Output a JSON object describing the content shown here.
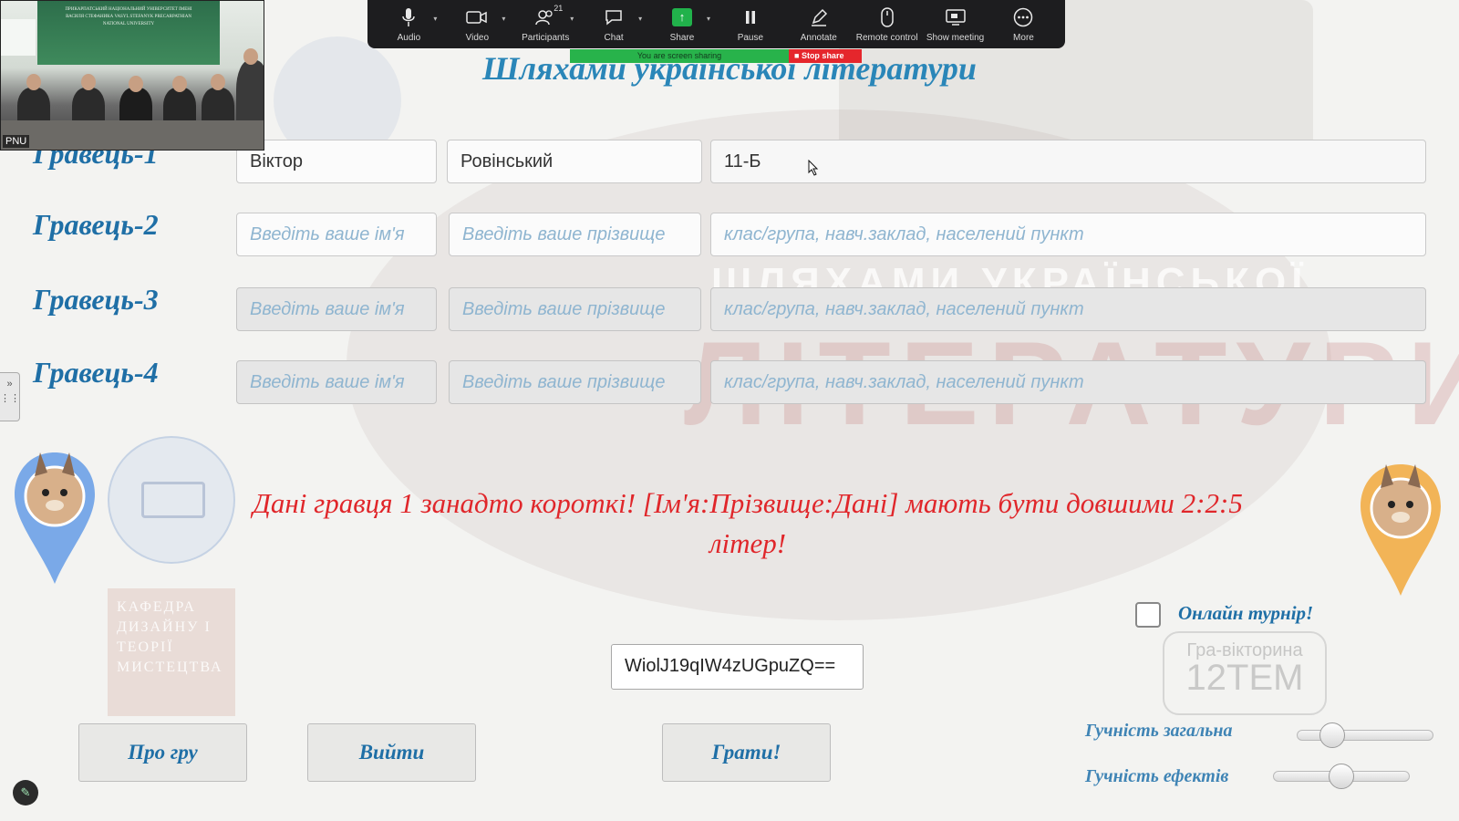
{
  "title": "Шляхами української літератури",
  "players": [
    {
      "label": "Гравець-1",
      "first_name": "Віктор",
      "last_name": "Ровінський",
      "info": "11-Б",
      "placeholder_first": "Введіть ваше ім'я",
      "placeholder_last": "Введіть ваше прізвище",
      "placeholder_info": "клас/група, навч.заклад, населений пункт"
    },
    {
      "label": "Гравець-2",
      "first_name": "",
      "last_name": "",
      "info": "",
      "placeholder_first": "Введіть ваше ім'я",
      "placeholder_last": "Введіть ваше прізвище",
      "placeholder_info": "клас/група, навч.заклад, населений пункт"
    },
    {
      "label": "Гравець-3",
      "first_name": "",
      "last_name": "",
      "info": "",
      "placeholder_first": "Введіть ваше ім'я",
      "placeholder_last": "Введіть ваше прізвище",
      "placeholder_info": "клас/група, навч.заклад, населений пункт"
    },
    {
      "label": "Гравець-4",
      "first_name": "",
      "last_name": "",
      "info": "",
      "placeholder_first": "Введіть ваше ім'я",
      "placeholder_last": "Введіть ваше прізвище",
      "placeholder_info": "клас/група, навч.заклад, населений пункт"
    }
  ],
  "error_message": "Дані гравця 1 занадто короткі! [Ім'я:Прізвище:Дані] мають бути довшими 2:2:5 літер!",
  "online_tournament_label": "Онлайн турнір!",
  "online_tournament_checked": false,
  "session_code": "WiolJ19qIW4zUGpuZQ==",
  "buttons": {
    "about": "Про гру",
    "exit": "Вийти",
    "play": "Грати!"
  },
  "volume": {
    "general_label": "Гучність загальна",
    "effects_label": "Гучність ефектів",
    "general_level": 0.2,
    "effects_level": 0.5
  },
  "background": {
    "words": [
      "ШЛЯХАМИ УКРАЇНСЬКОЇ",
      "ЛІТЕРАТУРИ"
    ],
    "quiz_badge_line1": "Гра-вікторина",
    "quiz_badge_line2": "12ТЕМ",
    "department_logo": "КАФЕДРА ДИЗАЙНУ І ТЕОРІЇ МИСТЕЦТВА"
  },
  "zoom_toolbar": {
    "items": [
      {
        "label": "Audio",
        "icon": "microphone-icon"
      },
      {
        "label": "Video",
        "icon": "video-camera-icon"
      },
      {
        "label": "Participants",
        "icon": "participants-icon",
        "count": "21"
      },
      {
        "label": "Chat",
        "icon": "chat-icon"
      },
      {
        "label": "Share",
        "icon": "share-screen-icon"
      },
      {
        "label": "Pause",
        "icon": "pause-icon"
      },
      {
        "label": "Annotate",
        "icon": "annotate-pen-icon"
      },
      {
        "label": "Remote control",
        "icon": "mouse-icon"
      },
      {
        "label": "Show meeting",
        "icon": "monitor-icon"
      },
      {
        "label": "More",
        "icon": "more-dots-icon"
      }
    ],
    "sharing_status": "You are screen sharing",
    "stop_share_label": "Stop share"
  },
  "video_thumbnail": {
    "name": "PNU",
    "banner_text": "ПРИКАРПАТСЬКИЙ НАЦІОНАЛЬНИЙ УНІВЕРСИТЕТ ІМЕНІ ВАСИЛЯ СТЕФАНИКА VASYL STEFANYK PRECARPATHIAN NATIONAL UNIVERSITY"
  },
  "colors": {
    "title": "#2a86b8",
    "labels": "#1f6fa6",
    "error": "#e0262a",
    "placeholder": "#8fb5d0",
    "share_green": "#28b34b",
    "stop_red": "#e5262c"
  }
}
